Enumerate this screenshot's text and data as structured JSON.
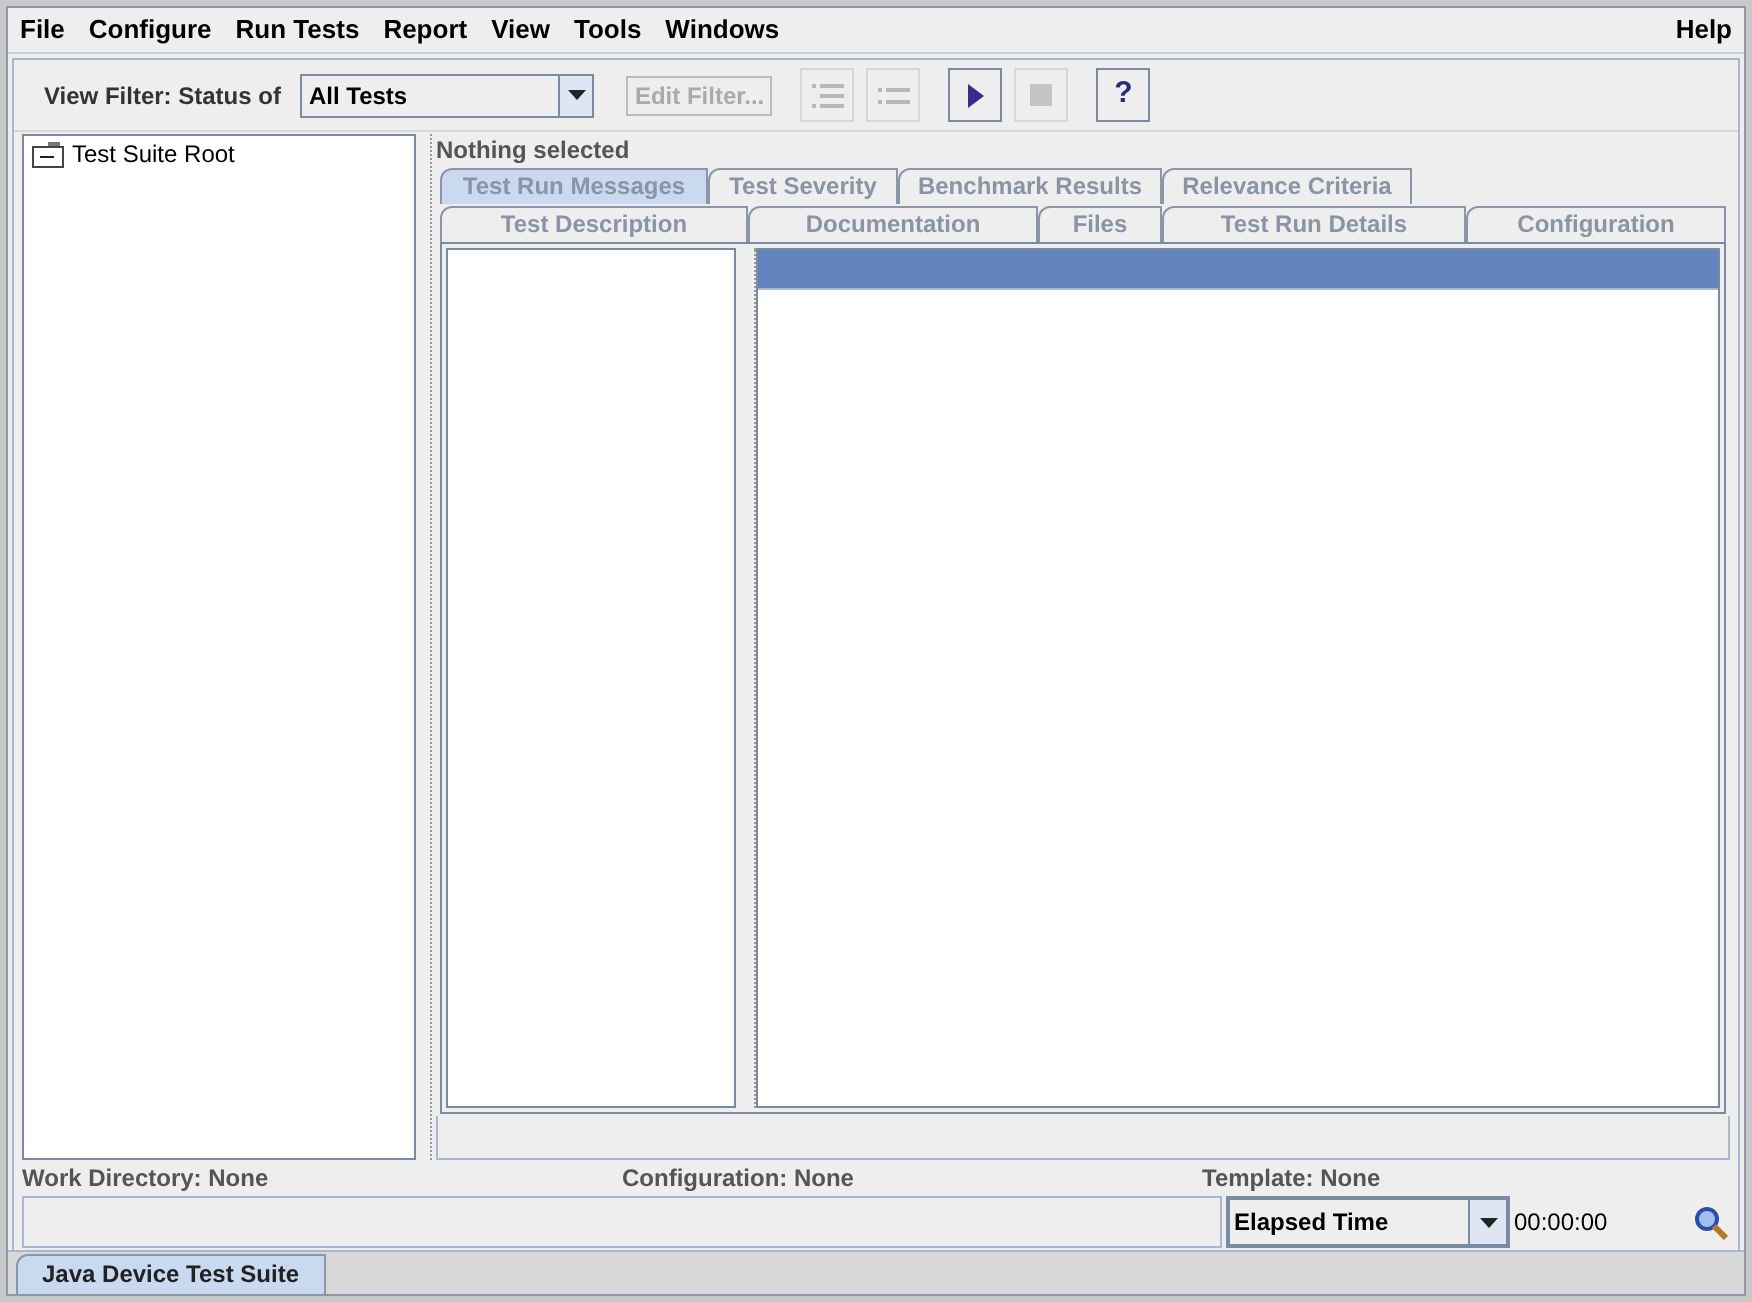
{
  "menu": [
    {
      "label": "File"
    },
    {
      "label": "Configure"
    },
    {
      "label": "Run Tests"
    },
    {
      "label": "Report"
    },
    {
      "label": "View"
    },
    {
      "label": "Tools"
    },
    {
      "label": "Windows"
    }
  ],
  "help_menu": {
    "label": "Help"
  },
  "toolbar": {
    "filter_label": "View Filter: Status of",
    "filter_select": {
      "value": "All Tests"
    },
    "buttons": [
      {
        "kind": "text",
        "label": "Edit Filter...",
        "disabled": true
      },
      {
        "kind": "expand",
        "disabled": true
      },
      {
        "kind": "collapse",
        "disabled": true
      },
      {
        "kind": "play",
        "disabled": false
      },
      {
        "kind": "stop",
        "disabled": true
      },
      {
        "kind": "help",
        "label": "?",
        "disabled": false
      }
    ]
  },
  "tree": {
    "items": [
      {
        "label": "Test Suite Root",
        "expanded": true
      }
    ]
  },
  "details": {
    "heading": "Nothing selected",
    "tab_rows": [
      {
        "tabs": [
          {
            "label": "Test Run Messages",
            "selected": true
          },
          {
            "label": "Test Severity",
            "selected": false
          },
          {
            "label": "Benchmark Results",
            "selected": false
          },
          {
            "label": "Relevance Criteria",
            "selected": false
          }
        ]
      },
      {
        "tabs": [
          {
            "label": "Test Description",
            "selected": false
          },
          {
            "label": "Documentation",
            "selected": false
          },
          {
            "label": "Files",
            "selected": false
          },
          {
            "label": "Test Run Details",
            "selected": false
          },
          {
            "label": "Configuration",
            "selected": false
          }
        ]
      }
    ]
  },
  "status": {
    "work_directory": "Work Directory: None",
    "configuration": "Configuration: None",
    "template": "Template: None",
    "timer_select": {
      "value": "Elapsed Time"
    },
    "timer": "00:00:00"
  },
  "bottom_tabs": [
    {
      "label": "Java Device Test Suite",
      "selected": true
    }
  ]
}
